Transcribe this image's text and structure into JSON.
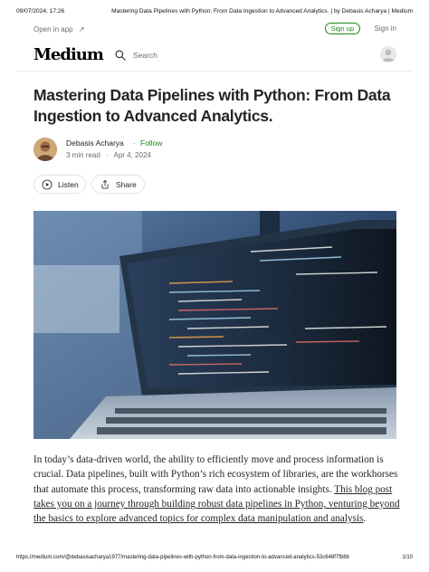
{
  "print_header": {
    "date": "09/07/2024, 17:26",
    "title": "Mastering Data Pipelines with Python: From Data Ingestion to Advanced Analytics. | by Debasis Acharya | Medium"
  },
  "topbar": {
    "open_in_app": "Open in app",
    "open_in_app_icon": "arrow-up-right-icon",
    "sign_up": "Sign up",
    "sign_in": "Sign in"
  },
  "navbar": {
    "logo": "Medium",
    "search_placeholder": "Search",
    "search_icon": "search-icon",
    "avatar_icon": "user-avatar-icon"
  },
  "article": {
    "title": "Mastering Data Pipelines with Python: From Data Ingestion to Advanced Analytics.",
    "author": "Debasis Acharya",
    "separator": "·",
    "follow": "Follow",
    "read_time": "3 min read",
    "meta_separator": "·",
    "date": "Apr 4, 2024",
    "listen": "Listen",
    "share": "Share",
    "body_plain": "In today’s data-driven world, the ability to efficiently move and process information is crucial. Data pipelines, built with Python’s rich ecosystem of libraries, are the workhorses that automate this process, transforming raw data into actionable insights. ",
    "body_link": "This blog post takes you on a journey through building robust data pipelines in Python, venturing beyond the basics to explore advanced topics for complex data manipulation and analysis",
    "body_end": "."
  },
  "colors": {
    "accent_green": "#1a8917",
    "text": "#242424",
    "muted": "#6b6b6b"
  },
  "print_footer": {
    "url": "https://medium.com/@debasisacharya1977/mastering-data-pipelines-with-python-from-data-ingestion-to-advanced-analytics-53c648f7fb8b",
    "page": "1/10"
  }
}
